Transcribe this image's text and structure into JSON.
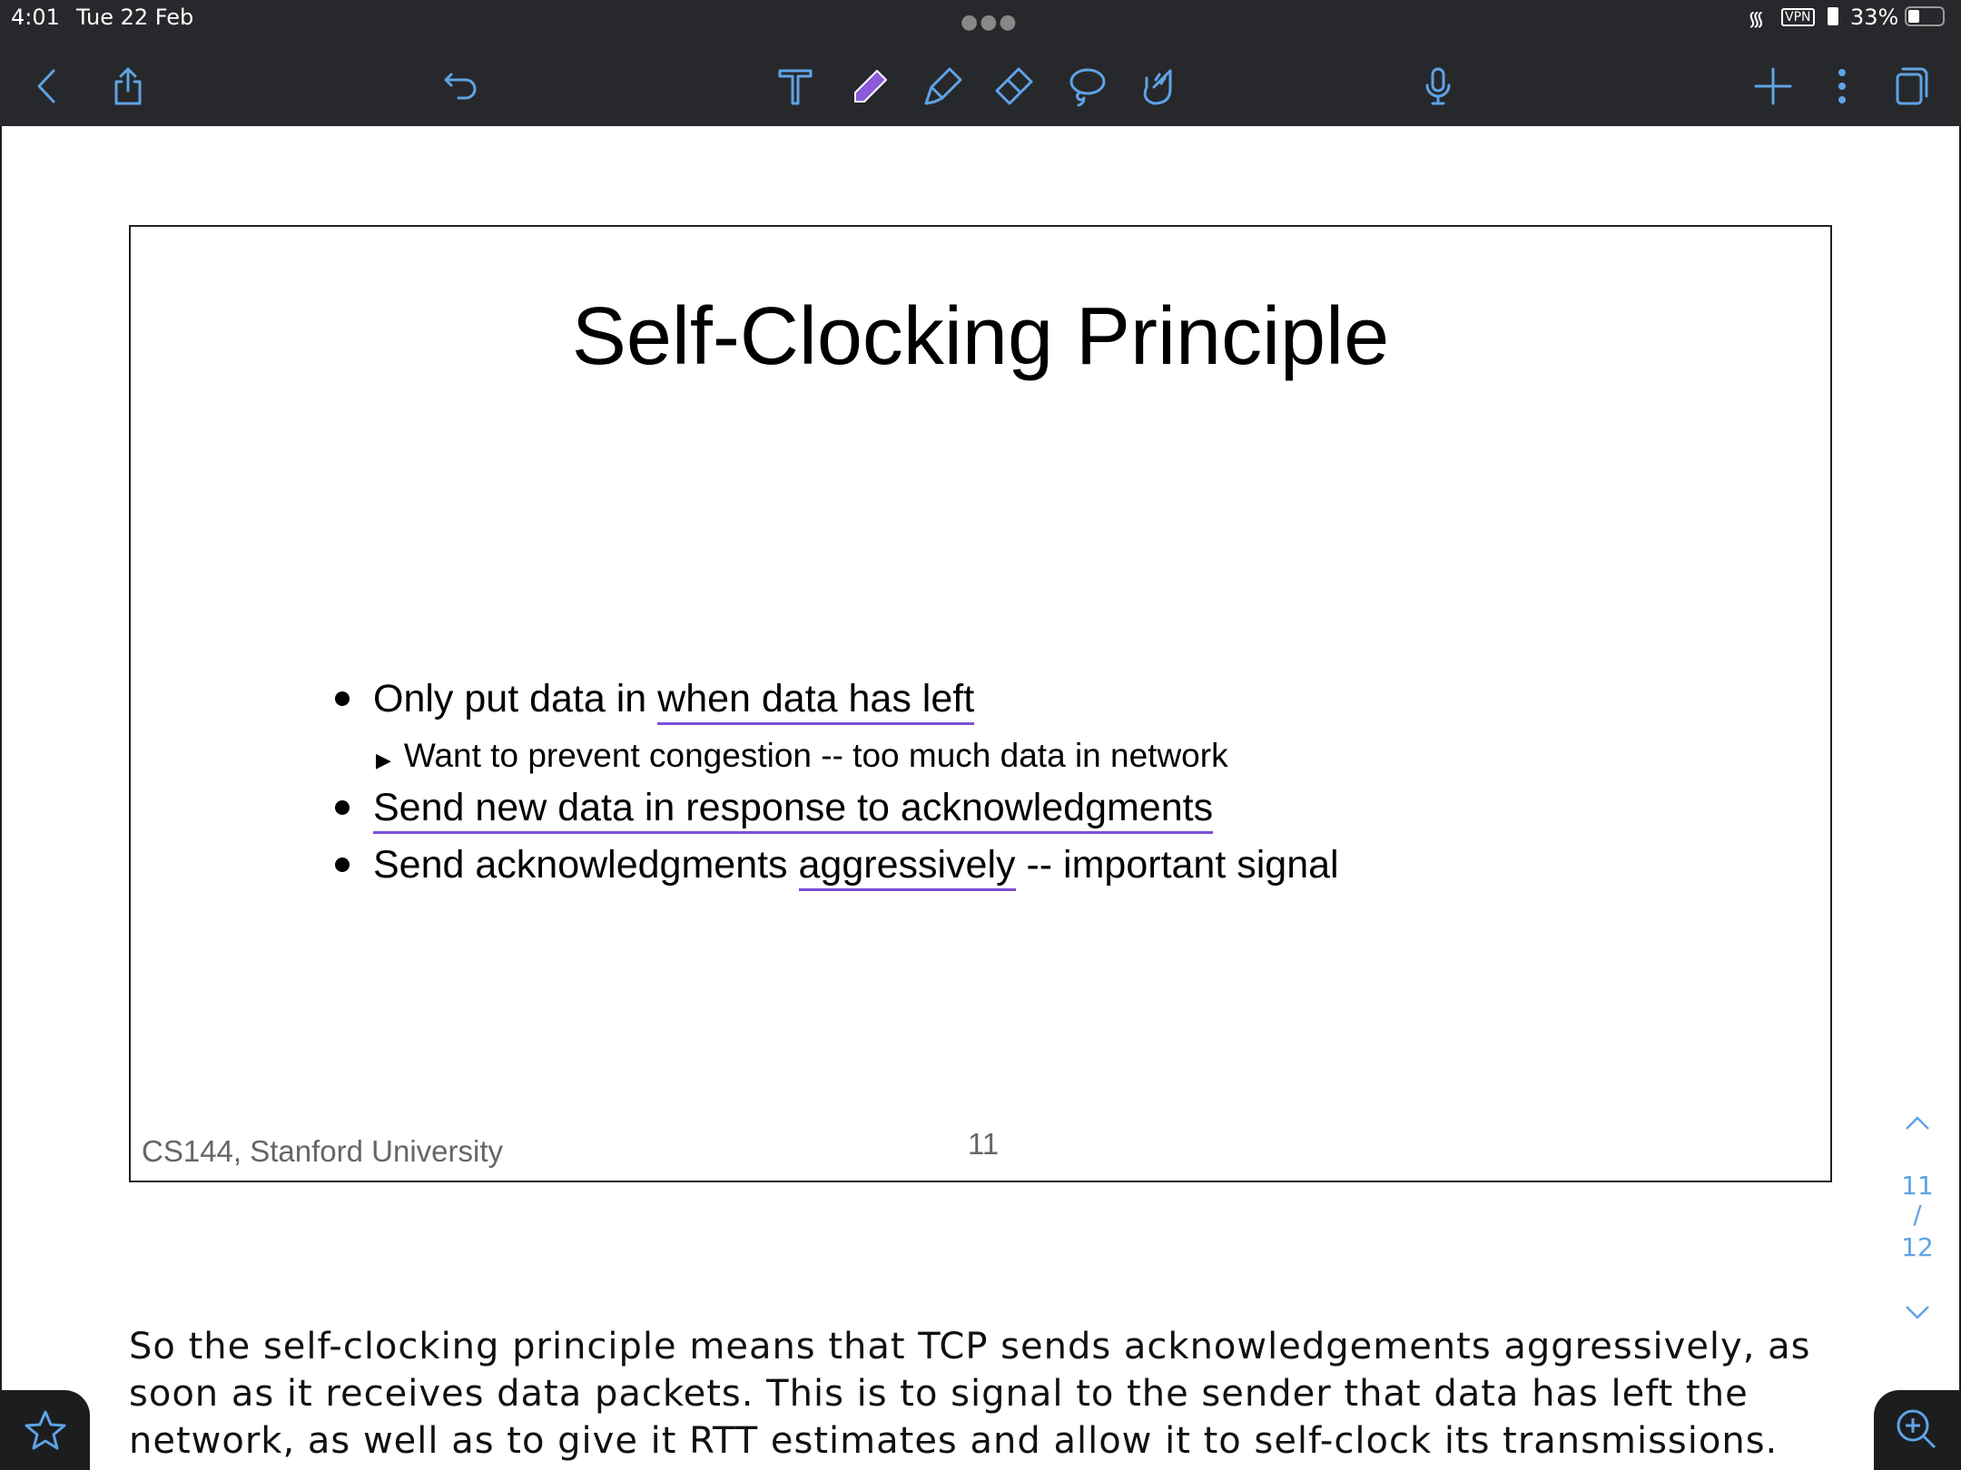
{
  "status_bar": {
    "time": "4:01",
    "date": "Tue 22 Feb",
    "vpn": "VPN",
    "battery": "33%"
  },
  "toolbar": {
    "icons": [
      "back-icon",
      "share-icon",
      "undo-icon",
      "text-tool-icon",
      "pen-icon",
      "highlighter-icon",
      "eraser-icon",
      "lasso-icon",
      "hand-icon",
      "microphone-icon",
      "add-icon",
      "more-icon",
      "pages-icon"
    ],
    "pen_color": "#8a5ad8"
  },
  "slide": {
    "title": "Self-Clocking Principle",
    "bullets": [
      {
        "pre": "Only put data in ",
        "u": "when data has left",
        "post": ""
      },
      {
        "sub": "Want to prevent congestion -- too much data in network"
      },
      {
        "pre": "",
        "u": "Send new data in response to acknowledgments",
        "post": ""
      },
      {
        "pre": "Send acknowledgments ",
        "u": "aggressively",
        "post": " -- important signal"
      }
    ],
    "footer": "CS144, Stanford University",
    "page_number": "11",
    "underline_color": "#7b4fd6"
  },
  "notes": "So the self-clocking principle means that TCP sends acknowledgements aggressively, as soon as it receives data packets. This is to signal to the sender that data has left the network, as well as to give it RTT estimates and allow it to self-clock its transmissions.",
  "pager": {
    "current": "11",
    "separator": "/",
    "total": "12"
  }
}
